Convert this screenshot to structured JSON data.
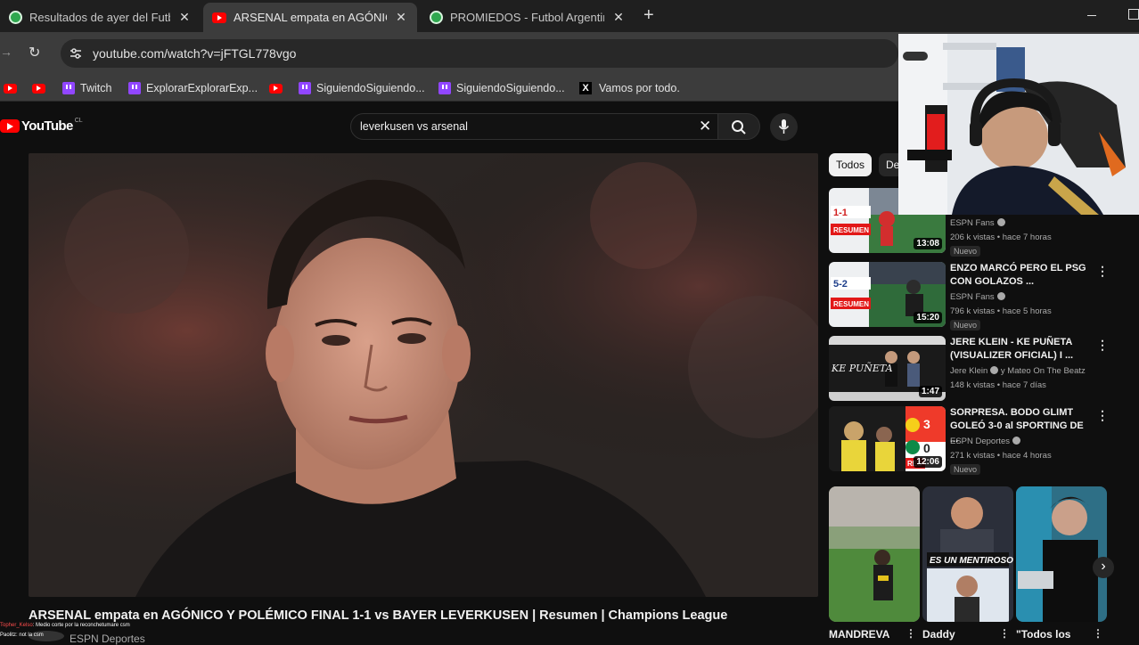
{
  "browser": {
    "tabs": [
      {
        "title": "Resultados de ayer del Futbol A",
        "icon": "soccer-ball-icon",
        "active": false
      },
      {
        "title": "ARSENAL empata en AGÓNICO",
        "icon": "youtube-icon",
        "active": true
      },
      {
        "title": "PROMIEDOS - Futbol Argentino",
        "icon": "soccer-ball-icon",
        "active": false
      }
    ],
    "url": "youtube.com/watch?v=jFTGL778vgo",
    "bookmarks": [
      {
        "label": "",
        "icon": "youtube-icon"
      },
      {
        "label": "",
        "icon": "youtube-icon"
      },
      {
        "label": "Twitch",
        "icon": "twitch-icon"
      },
      {
        "label": "ExplorarExplorarExp...",
        "icon": "twitch-icon"
      },
      {
        "label": "",
        "icon": "youtube-icon"
      },
      {
        "label": "SiguiendoSiguiendo...",
        "icon": "twitch-icon"
      },
      {
        "label": "SiguiendoSiguiendo...",
        "icon": "twitch-icon"
      },
      {
        "label": "Vamos por todo.",
        "icon": "x-icon"
      }
    ]
  },
  "youtube": {
    "logo_text": "YouTube",
    "country_code": "CL",
    "search_value": "leverkusen vs arsenal",
    "chips": [
      "Todos",
      "De"
    ],
    "video_title": "ARSENAL empata en AGÓNICO Y POLÉMICO FINAL 1-1 vs BAYER LEVERKUSEN | Resumen | Champions League",
    "channel": "ESPN Deportes",
    "recommendations": [
      {
        "title": "",
        "channel": "ESPN Fans",
        "meta": "206 k vistas • hace 7 horas",
        "badge": "Nuevo",
        "duration": "13:08",
        "thumb_text": "1-1",
        "thumb_label": "RESUMEN"
      },
      {
        "title": "ENZO MARCÓ PERO EL PSG CON GOLAZOS ...",
        "channel": "ESPN Fans",
        "meta": "796 k vistas • hace 5 horas",
        "badge": "Nuevo",
        "duration": "15:20",
        "thumb_text": "5-2",
        "thumb_label": "RESUMEN"
      },
      {
        "title": "JERE KLEIN - KE PUÑETA (VISUALIZER OFICIAL) I ...",
        "channel": "Jere Klein",
        "channel_extra": "y Mateo On The Beatz",
        "meta": "148 k vistas • hace 7 días",
        "badge": "",
        "duration": "1:47",
        "thumb_text": "KE PUÑETA",
        "thumb_label": ""
      },
      {
        "title": "SORPRESA. BODO GLIMT GOLEÓ 3-0 al SPORTING DE ...",
        "channel": "ESPN Deportes",
        "meta": "271 k vistas • hace 4 horas",
        "badge": "Nuevo",
        "duration": "12:06",
        "thumb_text": "3 0",
        "thumb_label": "RES"
      }
    ],
    "shorts": [
      {
        "title": "MANDREVA",
        "overlay": ""
      },
      {
        "title": "Daddy",
        "overlay": "ES UN MENTIROSO"
      },
      {
        "title": "\"Todos los",
        "overlay": ""
      }
    ]
  },
  "chat": [
    {
      "user": "Topher_Kelso",
      "text": "Medio corte por la reconchetumare csm"
    },
    {
      "user": "Paolitz",
      "text": "not la csm"
    }
  ],
  "colors": {
    "youtube_red": "#ff0000",
    "twitch_purple": "#9146ff",
    "page_bg": "#0f0f0f",
    "chrome_bg": "#3c3c3c"
  }
}
